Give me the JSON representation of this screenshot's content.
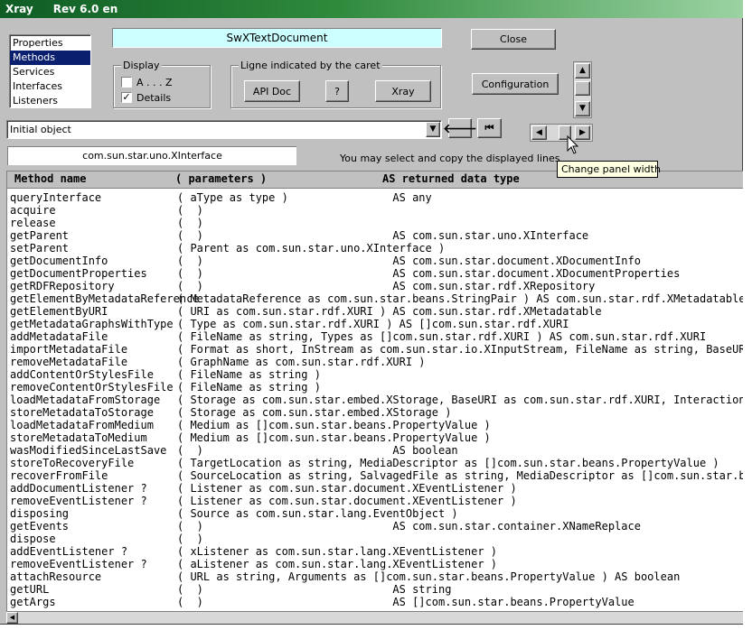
{
  "window": {
    "title": "Xray",
    "revision": "Rev 6.0 en"
  },
  "sections": [
    "Properties",
    "Methods",
    "Services",
    "Interfaces",
    "Listeners"
  ],
  "selected_section": "Methods",
  "object_name": "SwXTextDocument",
  "display_group": {
    "label": "Display",
    "az_label": "A . . . Z",
    "az_checked": false,
    "details_label": "Details",
    "details_checked": true
  },
  "caret_group": {
    "label": "Ligne indicated by the caret",
    "api_doc": "API Doc",
    "help": "?",
    "xray": "Xray"
  },
  "buttons": {
    "close": "Close",
    "configuration": "Configuration"
  },
  "path_combo": {
    "value": "Initial object"
  },
  "interface_field": "com.sun.star.uno.XInterface",
  "hint_text": "You may select and copy the displayed lines",
  "tooltip": "Change panel width",
  "columns": {
    "name": "Method name",
    "params": "(  parameters  )",
    "returns": "AS returned data type"
  },
  "rows": [
    [
      "queryInterface",
      "( aType as type )                AS any"
    ],
    [
      "acquire",
      "(  )"
    ],
    [
      "release",
      "(  )"
    ],
    [
      "getParent",
      "(  )                             AS com.sun.star.uno.XInterface"
    ],
    [
      "setParent",
      "( Parent as com.sun.star.uno.XInterface )"
    ],
    [
      "getDocumentInfo",
      "(  )                             AS com.sun.star.document.XDocumentInfo"
    ],
    [
      "getDocumentProperties",
      "(  )                             AS com.sun.star.document.XDocumentProperties"
    ],
    [
      "getRDFRepository",
      "(  )                             AS com.sun.star.rdf.XRepository"
    ],
    [
      "getElementByMetadataReference",
      "( MetadataReference as com.sun.star.beans.StringPair ) AS com.sun.star.rdf.XMetadatable"
    ],
    [
      "getElementByURI",
      "( URI as com.sun.star.rdf.XURI ) AS com.sun.star.rdf.XMetadatable"
    ],
    [
      "getMetadataGraphsWithType",
      "( Type as com.sun.star.rdf.XURI ) AS []com.sun.star.rdf.XURI"
    ],
    [
      "addMetadataFile",
      "( FileName as string, Types as []com.sun.star.rdf.XURI ) AS com.sun.star.rdf.XURI"
    ],
    [
      "importMetadataFile",
      "( Format as short, InStream as com.sun.star.io.XInputStream, FileName as string, BaseURI as"
    ],
    [
      "removeMetadataFile",
      "( GraphName as com.sun.star.rdf.XURI )"
    ],
    [
      "addContentOrStylesFile",
      "( FileName as string )"
    ],
    [
      "removeContentOrStylesFile",
      "( FileName as string )"
    ],
    [
      "loadMetadataFromStorage",
      "( Storage as com.sun.star.embed.XStorage, BaseURI as com.sun.star.rdf.XURI, InteractionHand"
    ],
    [
      "storeMetadataToStorage",
      "( Storage as com.sun.star.embed.XStorage )"
    ],
    [
      "loadMetadataFromMedium",
      "( Medium as []com.sun.star.beans.PropertyValue )"
    ],
    [
      "storeMetadataToMedium",
      "( Medium as []com.sun.star.beans.PropertyValue )"
    ],
    [
      "wasModifiedSinceLastSave",
      "(  )                             AS boolean"
    ],
    [
      "storeToRecoveryFile",
      "( TargetLocation as string, MediaDescriptor as []com.sun.star.beans.PropertyValue )"
    ],
    [
      "recoverFromFile",
      "( SourceLocation as string, SalvagedFile as string, MediaDescriptor as []com.sun.star.beans"
    ],
    [
      "addDocumentListener ?",
      "( Listener as com.sun.star.document.XEventListener )"
    ],
    [
      "removeEventListener ?",
      "( Listener as com.sun.star.document.XEventListener )"
    ],
    [
      "disposing",
      "( Source as com.sun.star.lang.EventObject )"
    ],
    [
      "getEvents",
      "(  )                             AS com.sun.star.container.XNameReplace"
    ],
    [
      "dispose",
      "(  )"
    ],
    [
      "addEventListener ?",
      "( xListener as com.sun.star.lang.XEventListener )"
    ],
    [
      "removeEventListener ?",
      "( aListener as com.sun.star.lang.XEventListener )"
    ],
    [
      "attachResource",
      "( URL as string, Arguments as []com.sun.star.beans.PropertyValue ) AS boolean"
    ],
    [
      "getURL",
      "(  )                             AS string"
    ],
    [
      "getArgs",
      "(  )                             AS []com.sun.star.beans.PropertyValue"
    ]
  ],
  "colors": {
    "title_bar": "#1a6b2e",
    "selection": "#0a1f6e",
    "object_field": "#ccffff",
    "tooltip": "#ffffe1"
  }
}
